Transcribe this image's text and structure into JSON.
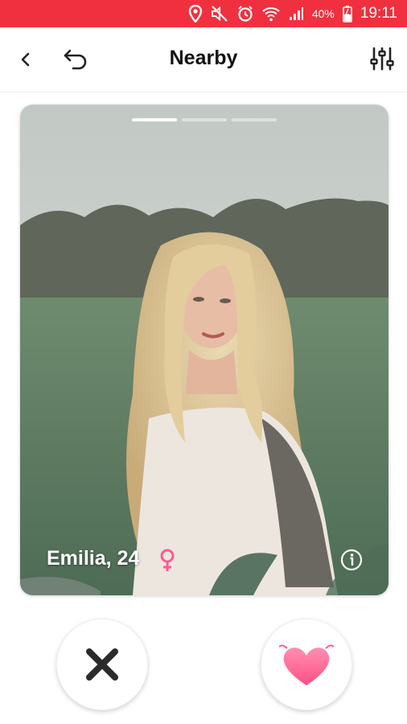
{
  "status_bar": {
    "icons": [
      "location-icon",
      "mute-icon",
      "alarm-icon",
      "wifi-icon",
      "signal-icon",
      "battery-charging-icon"
    ],
    "battery": "40%",
    "time": "19:11"
  },
  "header": {
    "title": "Nearby",
    "back_icon": "chevron-left-icon",
    "undo_icon": "undo-icon",
    "filter_icon": "filter-sliders-icon"
  },
  "card": {
    "photos_total": 3,
    "photo_active_index": 1,
    "name_age": "Emilia, 24",
    "gender_icon": "female-icon",
    "info_icon": "info-icon"
  },
  "actions": {
    "dislike_icon": "close-x-icon",
    "like_icon": "heart-icon"
  },
  "colors": {
    "status_bar": "#f0303e",
    "accent_pink": "#ff5a8f",
    "icon_dark": "#2b2b2b"
  }
}
